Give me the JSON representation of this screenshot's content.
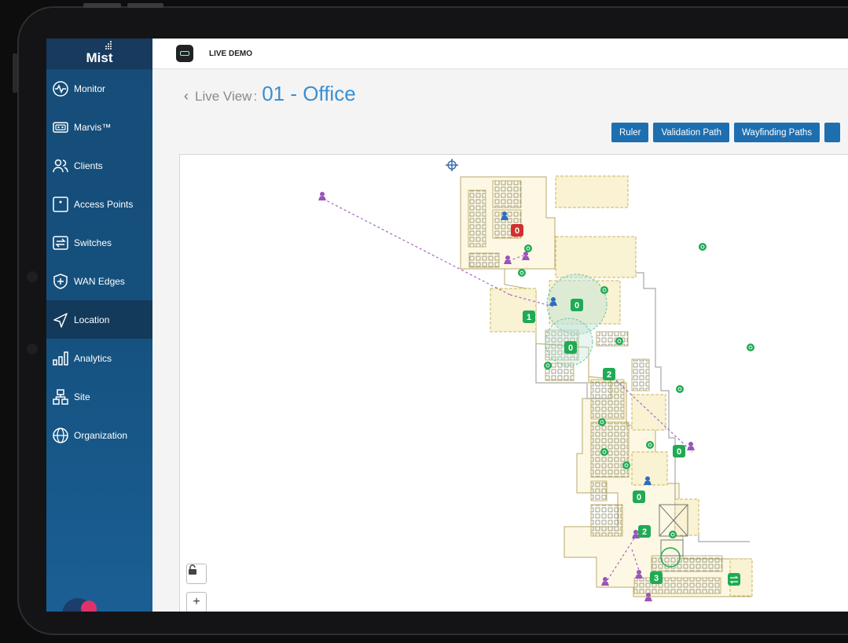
{
  "org": {
    "name": "LIVE DEMO"
  },
  "logo": {
    "text": "Mist"
  },
  "sidebar": {
    "items": [
      {
        "label": "Monitor",
        "icon": "pulse-icon"
      },
      {
        "label": "Marvis™",
        "icon": "marvis-icon"
      },
      {
        "label": "Clients",
        "icon": "clients-icon"
      },
      {
        "label": "Access Points",
        "icon": "access-point-icon"
      },
      {
        "label": "Switches",
        "icon": "switch-icon"
      },
      {
        "label": "WAN Edges",
        "icon": "wan-edge-icon"
      },
      {
        "label": "Location",
        "icon": "location-arrow-icon",
        "active": true
      },
      {
        "label": "Analytics",
        "icon": "analytics-icon"
      },
      {
        "label": "Site",
        "icon": "site-icon"
      },
      {
        "label": "Organization",
        "icon": "globe-icon"
      }
    ]
  },
  "header": {
    "back": "‹",
    "label": "Live View",
    "separator": ":",
    "title": "01 - Office"
  },
  "toolbar": {
    "ruler": "Ruler",
    "validation": "Validation Path",
    "wayfinding": "Wayfinding Paths"
  },
  "map": {
    "ap_counts": [
      "0",
      "0",
      "1",
      "0",
      "2",
      "0",
      "0",
      "2",
      "3"
    ],
    "zoom_in": "+",
    "lock_icon": "lock-icon"
  },
  "colors": {
    "accent": "#1d6fb0",
    "title": "#3a8fd1",
    "ap_green": "#1faa54",
    "ap_red": "#d0312d",
    "client_purple": "#9b55b8"
  }
}
